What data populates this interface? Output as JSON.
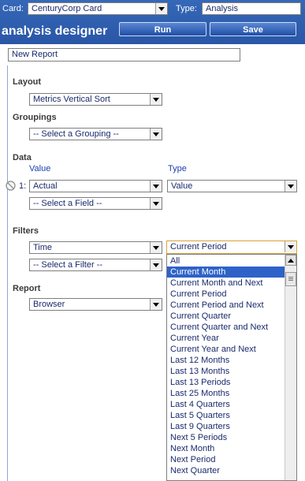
{
  "header": {
    "card_label": "Card:",
    "card_value": "CenturyCorp Card",
    "type_label": "Type:",
    "type_value": "Analysis",
    "title": "analysis designer",
    "run_label": "Run",
    "save_label": "Save"
  },
  "report_name": "New Report",
  "layout": {
    "label": "Layout",
    "value": "Metrics Vertical Sort"
  },
  "groupings": {
    "label": "Groupings",
    "value": "-- Select a Grouping --"
  },
  "data": {
    "label": "Data",
    "value_header": "Value",
    "type_header": "Type",
    "row_number": "1:",
    "row_value": "Actual",
    "row_type": "Value",
    "field_select": "-- Select a Field --"
  },
  "filters": {
    "label": "Filters",
    "field": "Time",
    "value": "Current Period",
    "filter_select": "-- Select a Filter --",
    "options": [
      "All",
      "Current Month",
      "Current Month and Next",
      "Current Period",
      "Current Period and Next",
      "Current Quarter",
      "Current Quarter and Next",
      "Current Year",
      "Current Year and Next",
      "Last 12 Months",
      "Last 13 Months",
      "Last 13 Periods",
      "Last 25 Months",
      "Last 4 Quarters",
      "Last 5 Quarters",
      "Last 9 Quarters",
      "Next 5 Periods",
      "Next Month",
      "Next Period",
      "Next Quarter"
    ],
    "highlighted_option": "Current Month"
  },
  "report": {
    "label": "Report",
    "value": "Browser"
  },
  "colors": {
    "header": "#2a56a6",
    "highlight": "#2e62c8",
    "text": "#1a2a6c",
    "focus_border": "#d6a23a"
  },
  "icons": {
    "remove_row": "no-entry-circle-icon"
  }
}
